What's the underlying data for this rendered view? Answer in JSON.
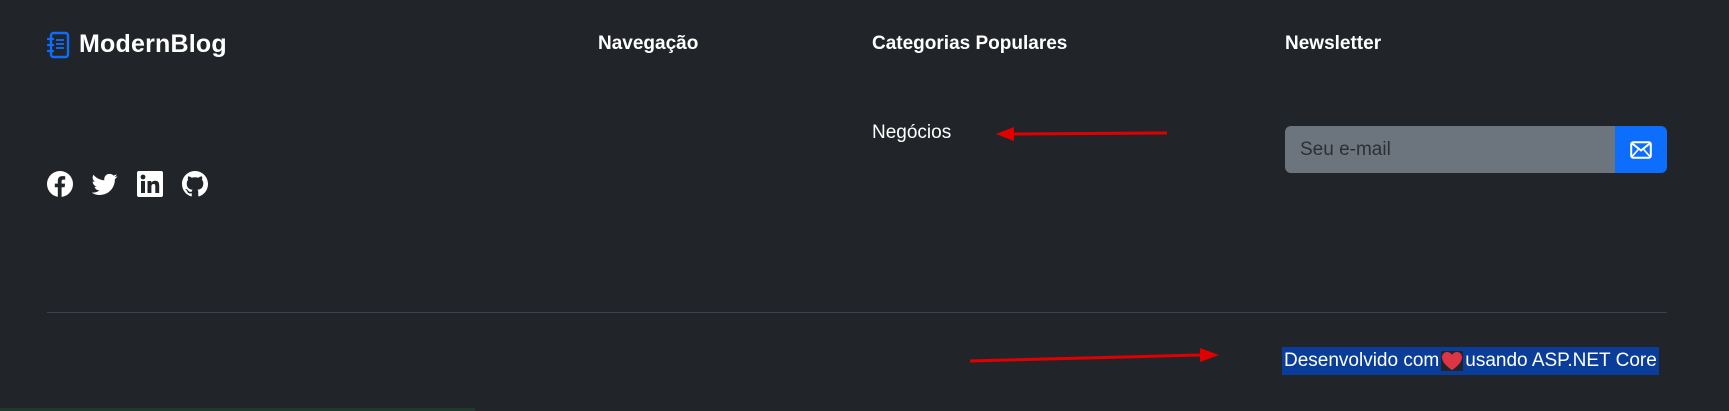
{
  "brand": {
    "name": "ModernBlog",
    "icon": "journal-icon"
  },
  "columns": {
    "navigation_title": "Navegação",
    "categories_title": "Categorias Populares",
    "newsletter_title": "Newsletter"
  },
  "categories": [
    "Negócios"
  ],
  "social": [
    "facebook-icon",
    "twitter-icon",
    "linkedin-icon",
    "github-icon"
  ],
  "newsletter": {
    "placeholder": "Seu e-mail",
    "button_icon": "envelope-icon"
  },
  "footer": {
    "credit_before": "Desenvolvido com",
    "credit_after": "usando ASP.NET Core"
  },
  "colors": {
    "background": "#212529",
    "primary": "#0d6efd",
    "input_bg": "#6c757d",
    "heart": "#dc3545",
    "annotation_arrow": "#e00000",
    "selection_highlight": "#0a3d9a"
  }
}
